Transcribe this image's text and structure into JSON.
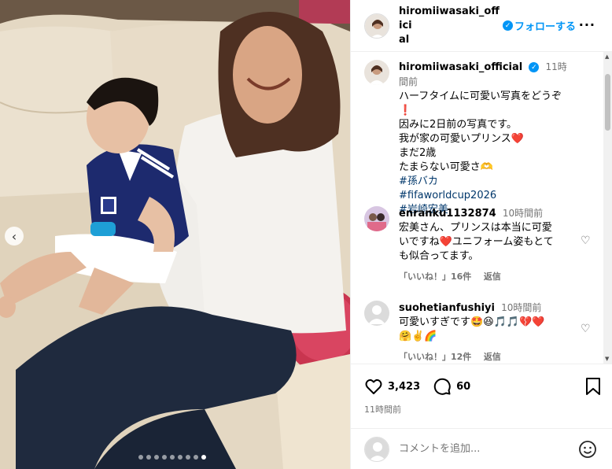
{
  "post": {
    "username": "hiromiiwasaki_official",
    "username_line1": "hiromiiwasaki_offici",
    "username_line2": "al",
    "follow_label": "フォローする",
    "more_label": "···",
    "caption": {
      "time": "11時間前",
      "lines": [
        "ハーフタイムに可愛い写真をどうぞ❗",
        "因みに2日前の写真です。",
        "我が家の可愛いプリンス❤️",
        "まだ2歳",
        "たまらない可愛さ🫶"
      ],
      "hashtags": [
        "#孫バカ",
        "#fifaworldcup2026",
        "#岩崎宏美"
      ]
    },
    "comments": [
      {
        "username": "enranku1132874",
        "time": "10時間前",
        "lines": [
          "宏美さん、プリンスは本当に可愛",
          "いですね❤️ユニフォーム姿もとて",
          "も似合ってます。"
        ],
        "likes": "「いいね！」16件",
        "reply": "返信"
      },
      {
        "username": "suohetianfushiyi",
        "time": "10時間前",
        "lines": [
          "可愛いすぎです🤩😆🎵🎵💔❤️",
          "🤗✌️🌈"
        ],
        "likes": "「いいね！」12件",
        "reply": "返信"
      }
    ],
    "like_count": "3,423",
    "comment_count": "60",
    "posted_time": "11時間前",
    "comment_placeholder": "コメントを追加...",
    "carousel": {
      "total": 9,
      "active": 9
    },
    "colors": {
      "accent": "#0095f6",
      "hashtag": "#00376b",
      "muted": "#737373"
    },
    "icons": {
      "heart": "heart-icon",
      "comment": "comment-icon",
      "bookmark": "bookmark-icon",
      "emoji": "emoji-icon",
      "prev": "chevron-left-icon",
      "verified": "verified-icon"
    }
  }
}
